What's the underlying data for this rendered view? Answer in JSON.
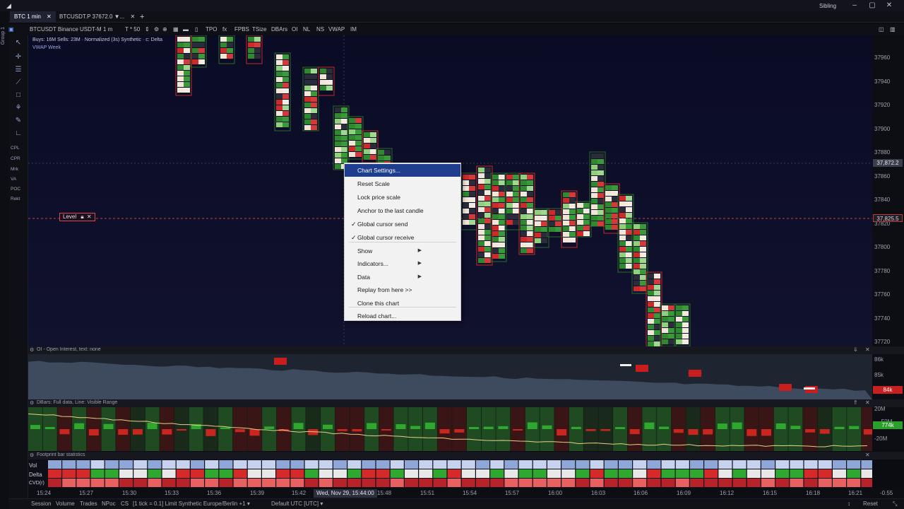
{
  "window": {
    "user": "Sibling"
  },
  "group_label": "Group 1",
  "tabs": [
    {
      "label": "BTC 1 min",
      "active": true
    },
    {
      "label": "BTCUSDT.P 37672.0 ▼...",
      "active": false
    }
  ],
  "toolbar": {
    "symbol": "BTCUSDT Binance USDT-M",
    "timeframe": "1 m",
    "ticks": "T * 50",
    "tpo": "TPO",
    "fx": "fx",
    "fpbs": "FPBS",
    "tsize": "TSize",
    "dbars": "DBArs",
    "oi": "OI",
    "nl": "NL",
    "ns": "NS",
    "vwap": "VWAP",
    "im": "IM"
  },
  "left_tools": {
    "cpl": "CPL",
    "cpr": "CPR",
    "mrk": "Mrk",
    "va": "VA",
    "poc": "POC",
    "rekt": "Rekt"
  },
  "chart": {
    "legend_line1": "Buys: 16M Sells: 23M · Normalized (3s) Synthetic · c: Delta",
    "legend_line2": "VWAP Week",
    "level_label": "Level",
    "price_labels": [
      "37960",
      "37940",
      "37920",
      "37900",
      "37880",
      "37860",
      "37840",
      "37820",
      "37800",
      "37780",
      "37760",
      "37740",
      "37720"
    ],
    "cursor_price": "37,872.2",
    "level_price": "37,825.5"
  },
  "context_menu": {
    "items": [
      {
        "label": "Chart Settings...",
        "highlight": true
      },
      {
        "label": "Reset Scale"
      },
      {
        "label": "Lock price scale"
      },
      {
        "label": "Anchor to the last candle"
      },
      {
        "label": "Global cursor send",
        "checked": true
      },
      {
        "label": "Global cursor receive",
        "checked": true
      },
      {
        "label": "Show",
        "submenu": true
      },
      {
        "label": "Indicators...",
        "submenu": true
      },
      {
        "label": "Data",
        "submenu": true
      },
      {
        "label": "Replay from here >>"
      },
      {
        "label": "Clone this chart"
      },
      {
        "label": "Reload chart..."
      }
    ]
  },
  "oi_pane": {
    "title": "OI - Open Interest, text: none",
    "scale": [
      "86k",
      "85k",
      "84k"
    ],
    "current": "84k"
  },
  "dbars_pane": {
    "title": "DBars: Full data, Line: Visible Range",
    "scale": [
      "20M",
      "-50M",
      "-20M"
    ],
    "current": "774k"
  },
  "stats_pane": {
    "title": "Footprint bar statistics",
    "rows": [
      "Vol",
      "Delta",
      "CVD(r)"
    ]
  },
  "time_axis": {
    "labels": [
      "15:24",
      "15:27",
      "15:30",
      "15:33",
      "15:36",
      "15:39",
      "15:42",
      "15:48",
      "15:51",
      "15:54",
      "15:57",
      "16:00",
      "16:03",
      "16:06",
      "16:09",
      "16:12",
      "16:15",
      "16:18",
      "16:21"
    ],
    "cursor": "Wed, Nov 29, 15:44:00",
    "scale_right": "-0.55"
  },
  "status": {
    "items": [
      "Session",
      "Volume",
      "Trades",
      "NPoc",
      "CS",
      "[1 tick = 0.1] Limit Synthetic Europe/Berlin +1 ▾",
      "Default UTC [UTC] ▾"
    ],
    "reset": "Reset"
  },
  "colors": {
    "buy": "#3da53d",
    "sell": "#d42a2a",
    "menu_highlight": "#1f3e8e",
    "background": "#0a0b24"
  }
}
